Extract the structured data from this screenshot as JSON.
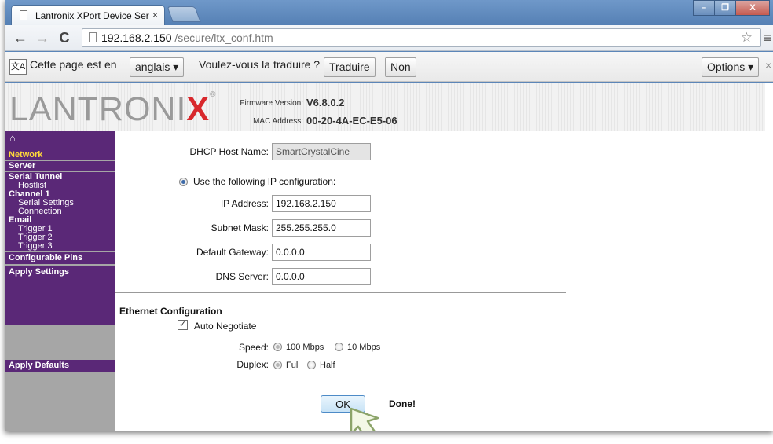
{
  "browser": {
    "tab_title": "Lantronix XPort Device Ser",
    "tab_close": "×",
    "url_host": "192.168.2.150",
    "url_path": "/secure/ltx_conf.htm",
    "window_minimize": "–",
    "window_maximize": "❐",
    "window_close": "X"
  },
  "translate_bar": {
    "icon_text": "文A",
    "text_prefix": "Cette page est en",
    "language": "anglais",
    "question": "Voulez-vous la traduire ?",
    "translate_button": "Traduire",
    "no_button": "Non",
    "options_button": "Options",
    "close": "×"
  },
  "header": {
    "logo_prefix": "LANTRONI",
    "logo_x": "X",
    "logo_reg": "®",
    "firmware_label": "Firmware Version:",
    "firmware_value": "V6.8.0.2",
    "mac_label": "MAC Address:",
    "mac_value": "00-20-4A-EC-E5-06"
  },
  "sidebar": {
    "items": [
      {
        "label": "Network",
        "level": 0,
        "active": true
      },
      {
        "label": "Server",
        "level": 0
      },
      {
        "label": "Serial Tunnel",
        "level": 0
      },
      {
        "label": "Hostlist",
        "level": 1
      },
      {
        "label": "Channel 1",
        "level": 0
      },
      {
        "label": "Serial Settings",
        "level": 1
      },
      {
        "label": "Connection",
        "level": 1
      },
      {
        "label": "Email",
        "level": 0
      },
      {
        "label": "Trigger 1",
        "level": 1
      },
      {
        "label": "Trigger 2",
        "level": 1
      },
      {
        "label": "Trigger 3",
        "level": 1
      },
      {
        "label": "Configurable Pins",
        "level": 0
      },
      {
        "label": "Apply Settings",
        "level": 0
      },
      {
        "label": "Apply Defaults",
        "level": 0
      }
    ]
  },
  "form": {
    "dhcp_host_label": "DHCP Host Name:",
    "dhcp_host_value": "SmartCrystalCine",
    "use_ip_label": "Use the following IP configuration:",
    "ip_label": "IP Address:",
    "ip_value": "192.168.2.150",
    "subnet_label": "Subnet Mask:",
    "subnet_value": "255.255.255.0",
    "gateway_label": "Default Gateway:",
    "gateway_value": "0.0.0.0",
    "dns_label": "DNS Server:",
    "dns_value": "0.0.0.0",
    "ethernet_title": "Ethernet Configuration",
    "auto_negotiate_label": "Auto Negotiate",
    "speed_label": "Speed:",
    "speed_100": "100 Mbps",
    "speed_10": "10 Mbps",
    "duplex_label": "Duplex:",
    "duplex_full": "Full",
    "duplex_half": "Half",
    "ok_button": "OK",
    "status": "Done!"
  }
}
